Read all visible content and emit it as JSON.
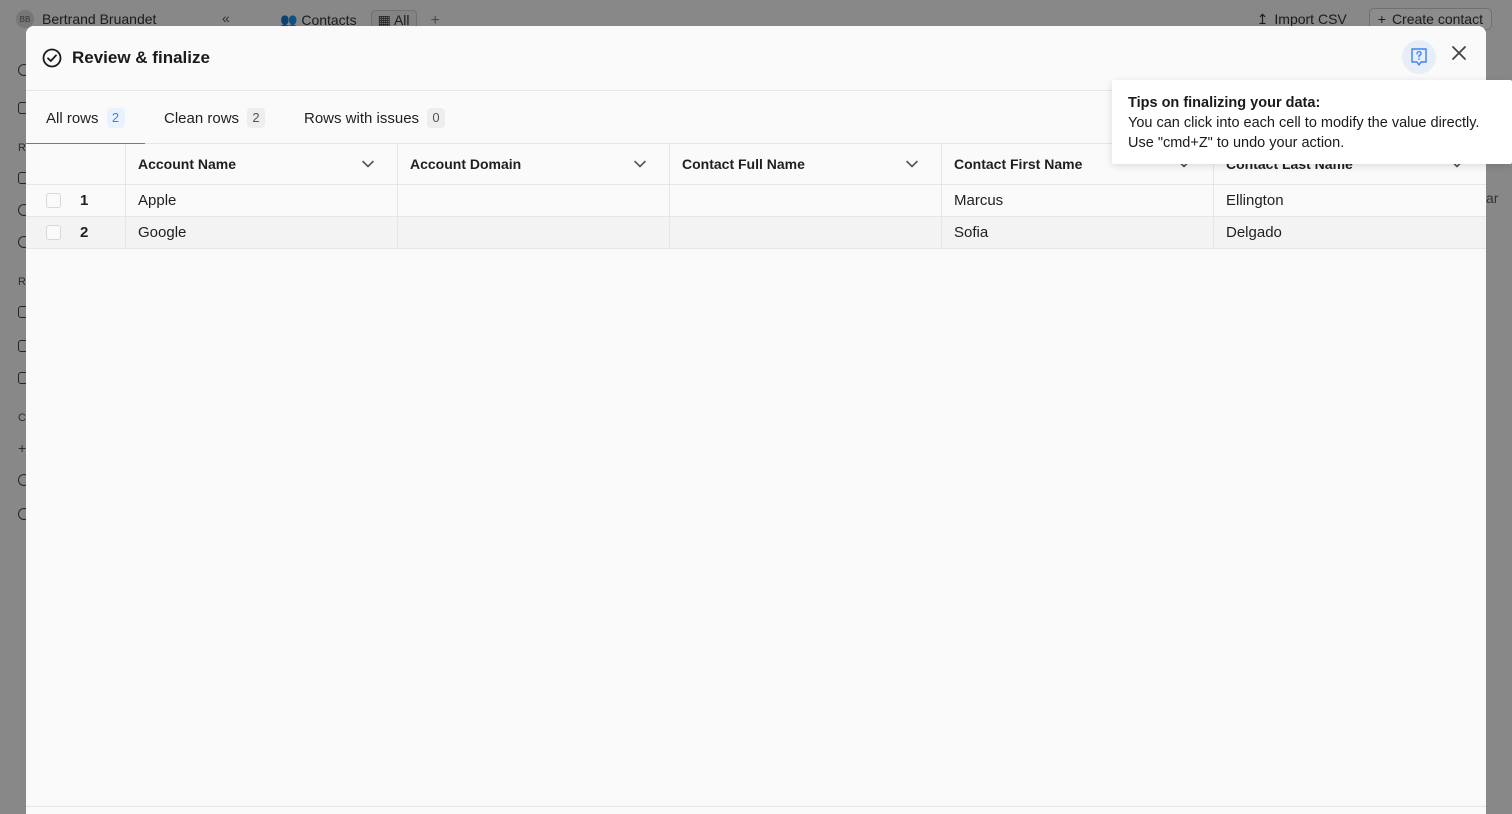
{
  "background": {
    "workspace": {
      "initials": "BB",
      "name": "Bertrand Bruandet"
    },
    "collapse_glyph": "«",
    "tabs": [
      {
        "label": "Contacts",
        "icon": "users-icon"
      },
      {
        "label": "All",
        "icon": "table-icon"
      }
    ],
    "add_tab_glyph": "+",
    "actions": [
      {
        "label": "Import CSV",
        "icon": "upload-icon"
      },
      {
        "label": "Create contact",
        "icon": "plus-icon"
      }
    ],
    "sidebar_letters": [
      "R",
      "R",
      "C"
    ],
    "peek_text": "ar"
  },
  "modal": {
    "title": "Review & finalize",
    "tabs": [
      {
        "label": "All rows",
        "count": "2",
        "active": true
      },
      {
        "label": "Clean rows",
        "count": "2",
        "active": false
      },
      {
        "label": "Rows with issues",
        "count": "0",
        "active": false
      }
    ],
    "columns": [
      "Account Name",
      "Account Domain",
      "Contact Full Name",
      "Contact First Name",
      "Contact Last Name"
    ],
    "rows": [
      {
        "num": "1",
        "cells": [
          "Apple",
          "",
          "",
          "Marcus",
          "Ellington"
        ]
      },
      {
        "num": "2",
        "cells": [
          "Google",
          "",
          "",
          "Sofia",
          "Delgado"
        ]
      }
    ]
  },
  "tooltip": {
    "title": "Tips on finalizing your data:",
    "line1": "You can click into each cell to modify the value directly.",
    "line2": "Use \"cmd+Z\" to undo your action."
  },
  "colors": {
    "accent": "#3b82f6",
    "accent_bg": "#eaf2ff"
  }
}
